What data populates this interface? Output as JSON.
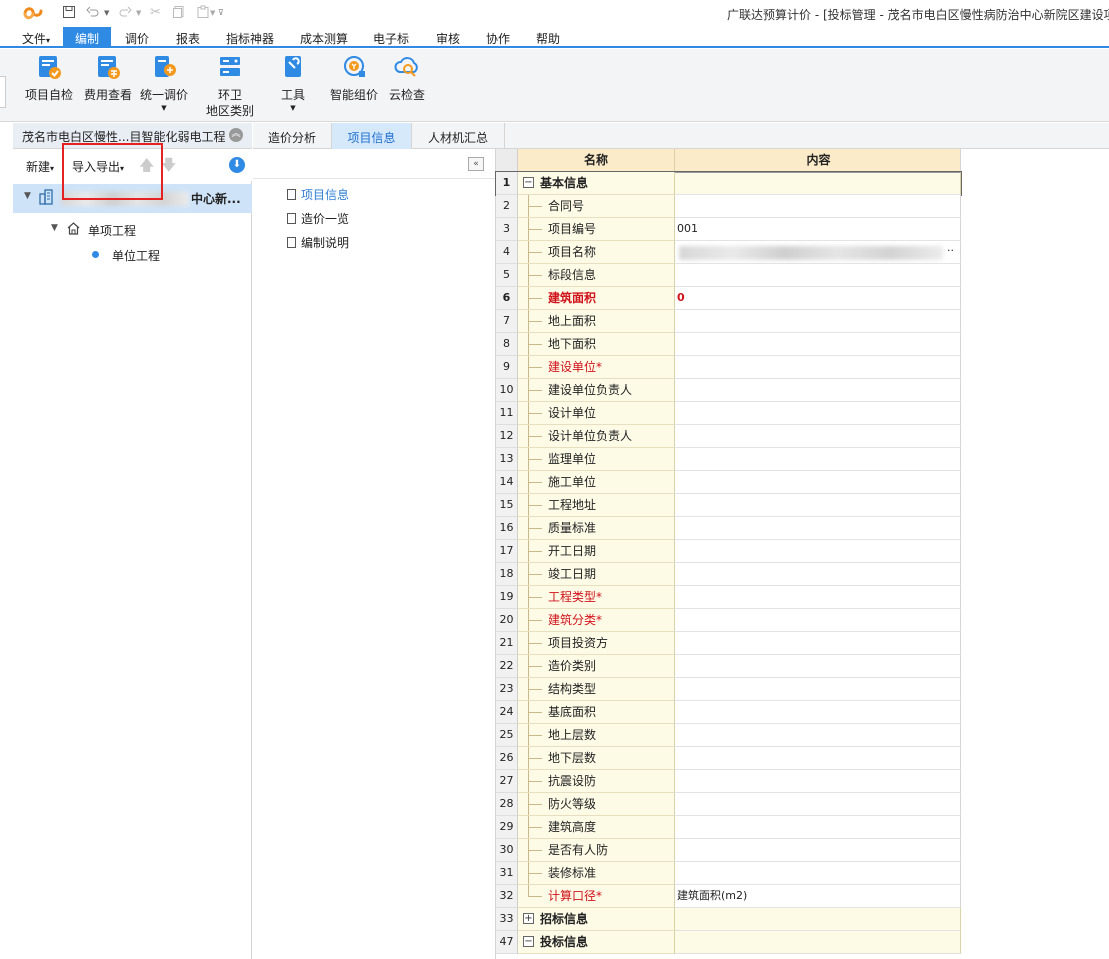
{
  "window": {
    "title": "广联达预算计价 - [投标管理 - 茂名市电白区慢性病防治中心新院区建设项"
  },
  "quick_access": [
    "save-icon",
    "undo-icon",
    "redo-icon",
    "cut-icon",
    "copy-icon",
    "paste-icon",
    "customize-icon"
  ],
  "menu": {
    "items": [
      "文件",
      "编制",
      "调价",
      "报表",
      "指标神器",
      "成本测算",
      "电子标",
      "审核",
      "协作",
      "帮助"
    ],
    "active": "编制"
  },
  "ribbon": {
    "buttons": [
      {
        "label": "项目自检",
        "icon": "check-icon"
      },
      {
        "label": "费用查看",
        "icon": "cost-view-icon"
      },
      {
        "label": "统一调价",
        "icon": "price-adjust-icon"
      },
      {
        "label": "环卫地区类别",
        "line1": "环卫",
        "line2": "地区类别",
        "icon": "area-category-icon"
      },
      {
        "label": "工具",
        "icon": "tools-icon"
      },
      {
        "label": "智能组价",
        "icon": "smart-price-icon"
      },
      {
        "label": "云检查",
        "icon": "cloud-check-icon"
      }
    ]
  },
  "left_panel": {
    "title": "茂名市电白区慢性...目智能化弱电工程",
    "toolbar": {
      "new": "新建",
      "import_export": "导入导出"
    },
    "tree": {
      "root_suffix": "中心新...",
      "child": "单项工程",
      "leaf": "单位工程"
    }
  },
  "tabs": [
    "造价分析",
    "项目信息",
    "人材机汇总"
  ],
  "active_tab": "项目信息",
  "nav": [
    "项目信息",
    "造价一览",
    "编制说明"
  ],
  "grid": {
    "headers": {
      "name": "名称",
      "content": "内容"
    },
    "rows": [
      {
        "n": "1",
        "name": "基本信息",
        "content": "",
        "type": "group"
      },
      {
        "n": "2",
        "name": "合同号",
        "content": ""
      },
      {
        "n": "3",
        "name": "项目编号",
        "content": "001"
      },
      {
        "n": "4",
        "name": "项目名称",
        "content": "..",
        "blur": true
      },
      {
        "n": "5",
        "name": "标段信息",
        "content": ""
      },
      {
        "n": "6",
        "name": "建筑面积",
        "content": "0",
        "style": "red-bold"
      },
      {
        "n": "7",
        "name": "地上面积",
        "content": ""
      },
      {
        "n": "8",
        "name": "地下面积",
        "content": ""
      },
      {
        "n": "9",
        "name": "建设单位*",
        "content": "",
        "style": "red"
      },
      {
        "n": "10",
        "name": "建设单位负责人",
        "content": ""
      },
      {
        "n": "11",
        "name": "设计单位",
        "content": ""
      },
      {
        "n": "12",
        "name": "设计单位负责人",
        "content": ""
      },
      {
        "n": "13",
        "name": "监理单位",
        "content": ""
      },
      {
        "n": "14",
        "name": "施工单位",
        "content": ""
      },
      {
        "n": "15",
        "name": "工程地址",
        "content": ""
      },
      {
        "n": "16",
        "name": "质量标准",
        "content": ""
      },
      {
        "n": "17",
        "name": "开工日期",
        "content": ""
      },
      {
        "n": "18",
        "name": "竣工日期",
        "content": ""
      },
      {
        "n": "19",
        "name": "工程类型*",
        "content": "",
        "style": "red"
      },
      {
        "n": "20",
        "name": "建筑分类*",
        "content": "",
        "style": "red"
      },
      {
        "n": "21",
        "name": "项目投资方",
        "content": ""
      },
      {
        "n": "22",
        "name": "造价类别",
        "content": ""
      },
      {
        "n": "23",
        "name": "结构类型",
        "content": ""
      },
      {
        "n": "24",
        "name": "基底面积",
        "content": ""
      },
      {
        "n": "25",
        "name": "地上层数",
        "content": ""
      },
      {
        "n": "26",
        "name": "地下层数",
        "content": ""
      },
      {
        "n": "27",
        "name": "抗震设防",
        "content": ""
      },
      {
        "n": "28",
        "name": "防火等级",
        "content": ""
      },
      {
        "n": "29",
        "name": "建筑高度",
        "content": ""
      },
      {
        "n": "30",
        "name": "是否有人防",
        "content": ""
      },
      {
        "n": "31",
        "name": "装修标准",
        "content": ""
      },
      {
        "n": "32",
        "name": "计算口径*",
        "content": "建筑面积(m2)",
        "style": "red",
        "last": true
      },
      {
        "n": "33",
        "name": "招标信息",
        "content": "",
        "type": "group",
        "collapsed": true
      },
      {
        "n": "47",
        "name": "投标信息",
        "content": "",
        "type": "group"
      }
    ]
  }
}
